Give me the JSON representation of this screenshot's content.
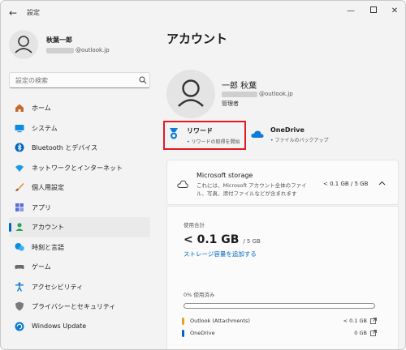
{
  "window": {
    "back_glyph": "←",
    "title": "設定",
    "controls": {
      "minimize": "—",
      "close": "✕"
    }
  },
  "profile": {
    "name": "秋葉一郎",
    "email_suffix": "@outlook.jp"
  },
  "search": {
    "placeholder": "設定の検索"
  },
  "nav": {
    "items": [
      {
        "label": "ホーム",
        "icon": "home-icon"
      },
      {
        "label": "システム",
        "icon": "system-icon"
      },
      {
        "label": "Bluetooth とデバイス",
        "icon": "bluetooth-icon"
      },
      {
        "label": "ネットワークとインターネット",
        "icon": "wifi-icon"
      },
      {
        "label": "個人用設定",
        "icon": "brush-icon"
      },
      {
        "label": "アプリ",
        "icon": "apps-icon"
      },
      {
        "label": "アカウント",
        "icon": "account-icon",
        "active": true
      },
      {
        "label": "時刻と言語",
        "icon": "time-language-icon"
      },
      {
        "label": "ゲーム",
        "icon": "gamepad-icon"
      },
      {
        "label": "アクセシビリティ",
        "icon": "accessibility-icon"
      },
      {
        "label": "プライバシーとセキュリティ",
        "icon": "shield-icon"
      },
      {
        "label": "Windows Update",
        "icon": "update-icon"
      }
    ]
  },
  "page": {
    "title": "アカウント",
    "account": {
      "name": "一郎 秋葉",
      "email_suffix": "@outlook.jp",
      "role": "管理者"
    },
    "quick_links": {
      "rewards": {
        "title": "リワード",
        "subtitle": "リワードの取得を開始"
      },
      "onedrive": {
        "title": "OneDrive",
        "subtitle": "ファイルのバックアップ"
      }
    },
    "storage": {
      "title": "Microsoft storage",
      "description": "これには、Microsoft アカウント全体のファイル、写真、添付ファイルなどが含まれます",
      "usage": "< 0.1 GB / 5 GB",
      "used_label": "使用合計",
      "used_value": "< 0.1 GB",
      "used_total": "/ 5 GB",
      "add_link": "ストレージ容量を追加する",
      "percent_label": "0% 使用済み",
      "percent_used": 0,
      "services": [
        {
          "name": "Outlook (Attachments)",
          "size": "< 0.1 GB",
          "color": "#e8a317"
        },
        {
          "name": "OneDrive",
          "size": "0 GB",
          "color": "#0067c0"
        }
      ]
    }
  },
  "colors": {
    "accent": "#0067c0",
    "highlight_box": "#e01b24"
  }
}
